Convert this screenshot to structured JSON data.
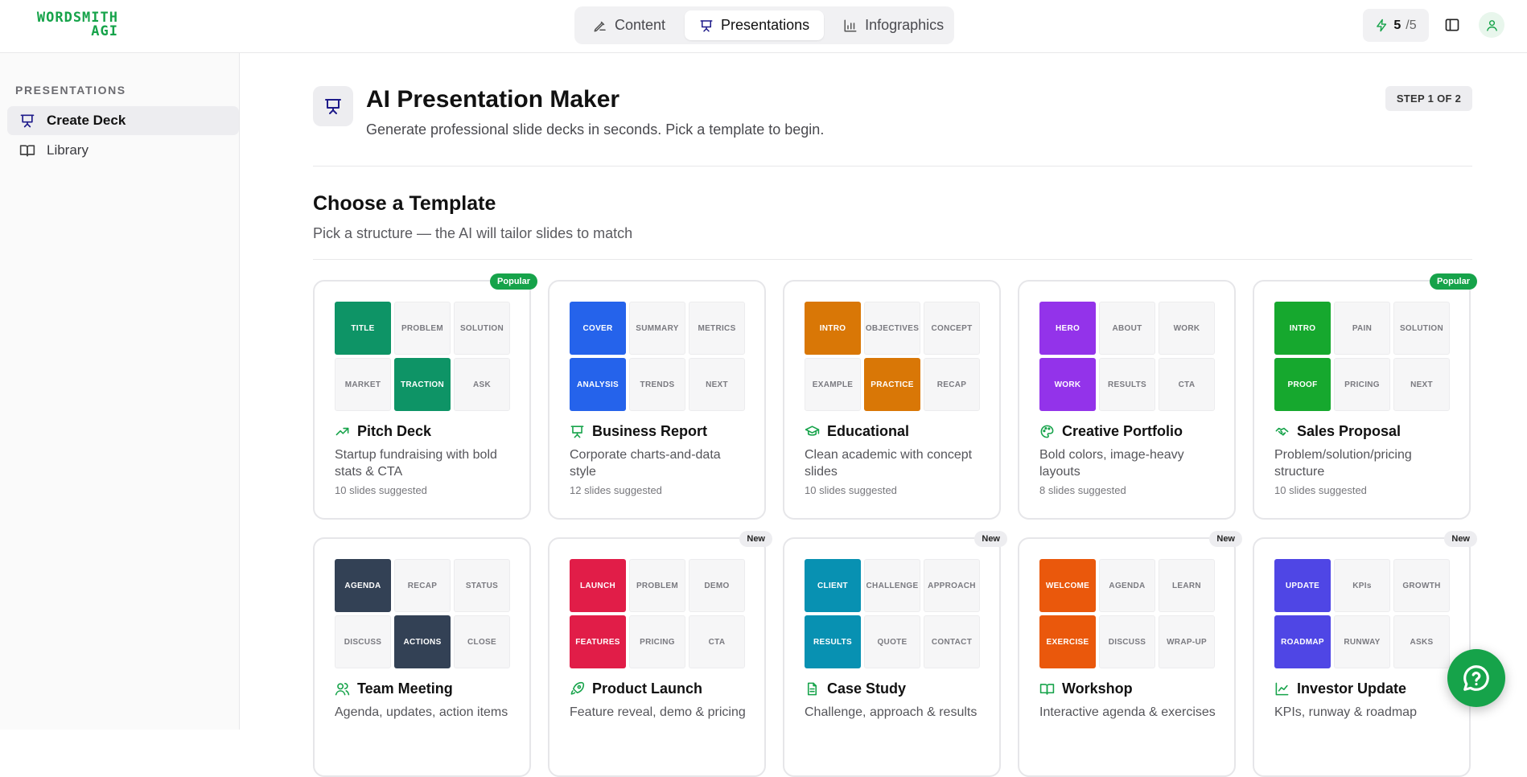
{
  "brand": {
    "line1": "WORDSMITH",
    "line2": "AGI",
    "color": "#16a34a"
  },
  "nav": {
    "tabs": [
      {
        "label": "Content",
        "icon": "pen-icon",
        "active": false
      },
      {
        "label": "Presentations",
        "icon": "presentation-icon",
        "active": true
      },
      {
        "label": "Infographics",
        "icon": "bar-chart-icon",
        "active": false
      }
    ]
  },
  "credits": {
    "current": "5",
    "total": "/5",
    "icon": "lightning-icon"
  },
  "sidebar": {
    "title": "PRESENTATIONS",
    "items": [
      {
        "label": "Create Deck",
        "icon": "presentation-icon",
        "active": true
      },
      {
        "label": "Library",
        "icon": "book-icon",
        "active": false
      }
    ]
  },
  "header": {
    "title": "AI Presentation Maker",
    "subtitle": "Generate professional slide decks in seconds. Pick a template to begin.",
    "step": "STEP 1 OF 2"
  },
  "section": {
    "title": "Choose a Template",
    "subtitle": "Pick a structure — the AI will tailor slides to match"
  },
  "templates": [
    {
      "name": "Pitch Deck",
      "icon": "trending-up-icon",
      "desc": "Startup fundraising with bold stats & CTA",
      "count": "10 slides suggested",
      "badge": "Popular",
      "color": "#0e9466",
      "cells": [
        "TITLE",
        "PROBLEM",
        "SOLUTION",
        "MARKET",
        "TRACTION",
        "ASK"
      ],
      "hl": [
        0,
        4
      ]
    },
    {
      "name": "Business Report",
      "icon": "presentation-icon",
      "desc": "Corporate charts-and-data style",
      "count": "12 slides suggested",
      "badge": "",
      "color": "#2563eb",
      "cells": [
        "COVER",
        "SUMMARY",
        "METRICS",
        "ANALYSIS",
        "TRENDS",
        "NEXT"
      ],
      "hl": [
        0,
        3
      ]
    },
    {
      "name": "Educational",
      "icon": "graduation-cap-icon",
      "desc": "Clean academic with concept slides",
      "count": "10 slides suggested",
      "badge": "",
      "color": "#d97706",
      "cells": [
        "INTRO",
        "OBJECTIVES",
        "CONCEPT",
        "EXAMPLE",
        "PRACTICE",
        "RECAP"
      ],
      "hl": [
        0,
        4
      ]
    },
    {
      "name": "Creative Portfolio",
      "icon": "palette-icon",
      "desc": "Bold colors, image-heavy layouts",
      "count": "8 slides suggested",
      "badge": "",
      "color": "#9333ea",
      "cells": [
        "HERO",
        "ABOUT",
        "WORK",
        "WORK",
        "RESULTS",
        "CTA"
      ],
      "hl": [
        0,
        3
      ]
    },
    {
      "name": "Sales Proposal",
      "icon": "handshake-icon",
      "desc": "Problem/solution/pricing structure",
      "count": "10 slides suggested",
      "badge": "Popular",
      "color": "#16a82e",
      "cells": [
        "INTRO",
        "PAIN",
        "SOLUTION",
        "PROOF",
        "PRICING",
        "NEXT"
      ],
      "hl": [
        0,
        3
      ]
    },
    {
      "name": "Team Meeting",
      "icon": "users-icon",
      "desc": "Agenda, updates, action items",
      "count": "",
      "badge": "",
      "color": "#334155",
      "cells": [
        "AGENDA",
        "RECAP",
        "STATUS",
        "DISCUSS",
        "ACTIONS",
        "CLOSE"
      ],
      "hl": [
        0,
        4
      ]
    },
    {
      "name": "Product Launch",
      "icon": "rocket-icon",
      "desc": "Feature reveal, demo & pricing",
      "count": "",
      "badge": "New",
      "color": "#e11d48",
      "cells": [
        "LAUNCH",
        "PROBLEM",
        "DEMO",
        "FEATURES",
        "PRICING",
        "CTA"
      ],
      "hl": [
        0,
        3
      ]
    },
    {
      "name": "Case Study",
      "icon": "document-icon",
      "desc": "Challenge, approach & results",
      "count": "",
      "badge": "New",
      "color": "#0891b2",
      "cells": [
        "CLIENT",
        "CHALLENGE",
        "APPROACH",
        "RESULTS",
        "QUOTE",
        "CONTACT"
      ],
      "hl": [
        0,
        3
      ]
    },
    {
      "name": "Workshop",
      "icon": "book-icon",
      "desc": "Interactive agenda & exercises",
      "count": "",
      "badge": "New",
      "color": "#ea580c",
      "cells": [
        "WELCOME",
        "AGENDA",
        "LEARN",
        "EXERCISE",
        "DISCUSS",
        "WRAP-UP"
      ],
      "hl": [
        0,
        3
      ]
    },
    {
      "name": "Investor Update",
      "icon": "line-chart-icon",
      "desc": "KPIs, runway & roadmap",
      "count": "",
      "badge": "New",
      "color": "#4f46e5",
      "cells": [
        "UPDATE",
        "KPIs",
        "GROWTH",
        "ROADMAP",
        "RUNWAY",
        "ASKS"
      ],
      "hl": [
        0,
        3
      ]
    }
  ],
  "help": {
    "icon": "help-chat-icon",
    "color": "#16a34a"
  }
}
